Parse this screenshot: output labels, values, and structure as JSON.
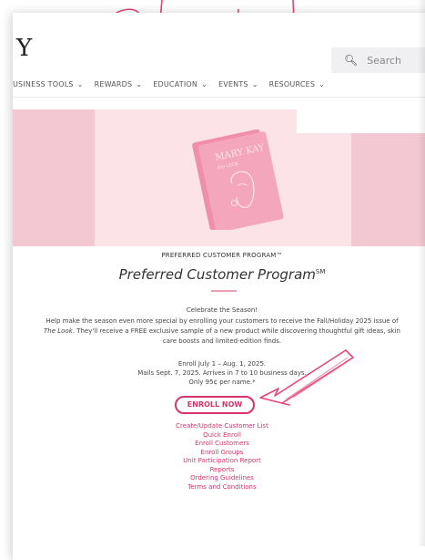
{
  "header": {
    "logo_glyph": "Y",
    "search_placeholder": "Search"
  },
  "nav": {
    "items": [
      {
        "label": "USINESS TOOLS"
      },
      {
        "label": "REWARDS"
      },
      {
        "label": "EDUCATION"
      },
      {
        "label": "EVENTS"
      },
      {
        "label": "RESOURCES"
      }
    ]
  },
  "hero": {
    "catalog_brand": "MARY KAY",
    "catalog_sub": "the LOOK"
  },
  "program": {
    "kicker": "PREFERRED CUSTOMER PROGRAM™",
    "title": "Preferred Customer Program",
    "title_mark": "SM",
    "celebrate": "Celebrate the Season!",
    "desc_part1": "Help make the season even more special by enrolling your customers to receive the Fall/Holiday 2025 issue of ",
    "desc_italic1": "The Look",
    "desc_part2": ". They'll receive a FREE exclusive sample of a new product while discovering thoughtful gift ideas, skin care boosts and limited-edition finds.",
    "enroll_line1": "Enroll July 1 – Aug. 1, 2025.",
    "enroll_line2": "Mails Sept. 7, 2025. Arrives in 7 to 10 business days.",
    "enroll_line3": "Only 95¢ per name.*",
    "enroll_button": "ENROLL NOW"
  },
  "links": [
    {
      "label": "Create/Update Customer List"
    },
    {
      "label": "Quick Enroll"
    },
    {
      "label": "Enroll Customers"
    },
    {
      "label": "Enroll Groups"
    },
    {
      "label": "Unit Participation Report"
    },
    {
      "label": "Reports"
    },
    {
      "label": "Ordering Guidelines"
    },
    {
      "label": "Terms and Conditions"
    }
  ],
  "colors": {
    "accent": "#d6336c",
    "hero_pink": "#f4c8d3",
    "hero_light": "#fbe3e8"
  }
}
